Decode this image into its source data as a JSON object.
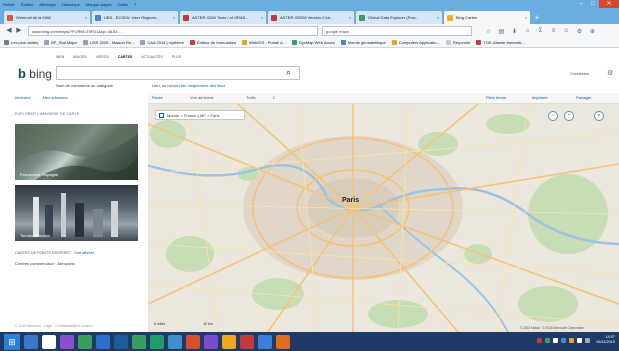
{
  "window": {
    "menu": [
      "Fichier",
      "Édition",
      "Affichage",
      "Historique",
      "Marque-pages",
      "Outils",
      "?"
    ],
    "controls": [
      "–",
      "□",
      "✕"
    ]
  },
  "tabs": [
    {
      "label": "Webmail de la MAE",
      "favicon_color": "#d85b3b"
    },
    {
      "label": "UBS - ECSDV: User Regions...",
      "favicon_color": "#4b86c9"
    },
    {
      "label": "ASTER GDM Tools / of GRAIL...",
      "favicon_color": "#c23a3a"
    },
    {
      "label": "ASTER GDEM Version 2 ful...",
      "favicon_color": "#c23a3a"
    },
    {
      "label": "Global Data Explorer (Pow...",
      "favicon_color": "#3a9e5e"
    },
    {
      "label": "Bing Cartes",
      "favicon_color": "#f2b21c",
      "active": true
    }
  ],
  "new_tab_label": "+",
  "nav": {
    "url": "www.bing.com/maps/?FORM=Z9FD1&cp=48.84...",
    "search_value": "google maps",
    "icons": [
      "star-icon",
      "clipboard-icon",
      "download-icon",
      "home-icon",
      "sigma-icon",
      "menu-icon",
      "smile-icon",
      "settings-icon",
      "zoom-icon"
    ]
  },
  "bookmarks": [
    {
      "label": "Les plus visités",
      "color": "#6f7f8f"
    },
    {
      "label": "BP_Stat Major",
      "color": "#8aa2c0"
    },
    {
      "label": "USR 3225 - Maison Re...",
      "color": "#8aa2c0"
    },
    {
      "label": "CAA 2014 | mythiere",
      "color": "#8aa2c0"
    },
    {
      "label": "Éditeur de formulaires",
      "color": "#c83a3a"
    },
    {
      "label": "WebGIS - Portail d...",
      "color": "#e0a81c"
    },
    {
      "label": "DynMap Web Acces",
      "color": "#3a9e5e"
    },
    {
      "label": "Monde géosatelitique",
      "color": "#4b86c9"
    },
    {
      "label": "Computers Applicatio...",
      "color": "#e0a81c"
    },
    {
      "label": "Répondre",
      "color": "#cccccc"
    },
    {
      "label": "TOE-Atlante thematic...",
      "color": "#c23a3a"
    }
  ],
  "scopes": [
    {
      "label": "WEB",
      "active": false
    },
    {
      "label": "IMAGES",
      "active": false
    },
    {
      "label": "VIDÉOS",
      "active": false
    },
    {
      "label": "CARTES",
      "active": true
    },
    {
      "label": "ACTUALITÉS",
      "active": false
    },
    {
      "label": "PLUS",
      "active": false
    }
  ],
  "logo": {
    "mark": "b",
    "text": "bing"
  },
  "search": {
    "value": ""
  },
  "suggestions": {
    "hint": "Nom de commerce ou catégorie",
    "prefix": "Lieu, ou",
    "link": "rechercher uniquement des lieux"
  },
  "header_right": {
    "signin": "Connexion"
  },
  "sidebar": {
    "tools": [
      "Itinéraire",
      "Mes adresses"
    ],
    "explore_title": "EXPLORER L'IMAGERIE DE CARTE",
    "thumbs": [
      {
        "caption": "Portocolom, Espagne"
      },
      {
        "caption": "Toronto, Canada"
      }
    ],
    "poi_title": "CARTES DE POINTS D'INTÉRÊT",
    "poi_link": "Tout afficher",
    "poi_items": "Centres commerciaux · Aéroports",
    "footer": "© 2015 Microsoft · Légal · Confidentialité et cookies"
  },
  "map_toolbar": {
    "left": [
      "Route",
      "Vue aérienne",
      "Trafic",
      "⇩"
    ],
    "right": [
      "Plein écran",
      "Imprimer",
      "Partager"
    ]
  },
  "map": {
    "overlay_label": "Monde > France (-MF > Paris",
    "main_label": "Paris",
    "nav_controls": [
      "−",
      "+",
      "⌖"
    ],
    "scale": [
      "5 miles",
      "10 km"
    ],
    "copyright": "© 2015 Nokia · © 2015 Microsoft Corporation"
  },
  "taskbar": {
    "start": "⊞",
    "apps": [
      "#3a78c9",
      "#ffffff",
      "#8a4fcf",
      "#3a9e5e",
      "#2c6fd0",
      "#1d5d9a",
      "#3a9e5e",
      "#1f9e6a",
      "#3f8ed0",
      "#d84f2c",
      "#7a4ad0",
      "#f0a61c",
      "#c23a3a",
      "#3d7fd8",
      "#e06b1c"
    ],
    "tray_colors": [
      "#c23a3a",
      "#3a9e5e",
      "#ffffff",
      "#4b86c9",
      "#e0a81c",
      "#ffffff",
      "#9aa8b8"
    ],
    "time": "14:07",
    "date": "06/11/2015"
  }
}
